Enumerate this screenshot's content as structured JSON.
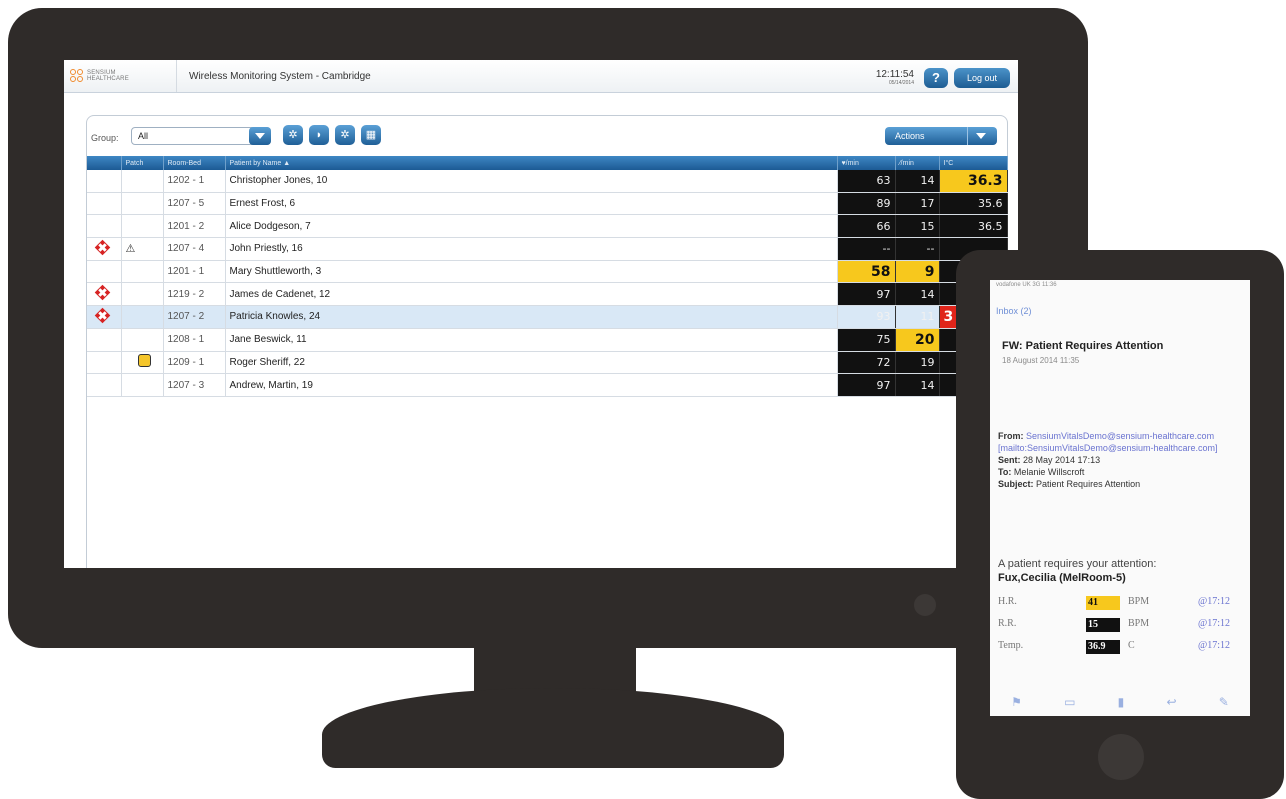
{
  "app": {
    "logo_text_line1": "SENSIUM",
    "logo_text_line2": "HEALTHCARE",
    "title": "Wireless Monitoring System - Cambridge",
    "time": "12:11:54",
    "date": "05/14/2014",
    "help_label": "?",
    "logout_label": "Log out"
  },
  "toolbar": {
    "group_label": "Group:",
    "group_value": "All",
    "actions_label": "Actions"
  },
  "table": {
    "headers": [
      "",
      "Patch",
      "Room-Bed",
      "Patient by Name ▲",
      "♥/min",
      "⁄/min",
      "I°C"
    ],
    "rows": [
      {
        "room": "1202 - 1",
        "name": "Christopher Jones, 10",
        "hr": "63",
        "rr": "14",
        "temp": "36.3"
      },
      {
        "room": "1207 - 5",
        "name": "Ernest Frost, 6",
        "hr": "89",
        "rr": "17",
        "temp": "35.6"
      },
      {
        "room": "1201 - 2",
        "name": "Alice Dodgeson, 7",
        "hr": "66",
        "rr": "15",
        "temp": "36.5"
      },
      {
        "room": "1207 - 4",
        "name": "John Priestly, 16",
        "hr": "--",
        "rr": "--",
        "temp": ""
      },
      {
        "room": "1201 - 1",
        "name": "Mary Shuttleworth,  3",
        "hr": "58",
        "rr": "9",
        "temp": ""
      },
      {
        "room": "1219 - 2",
        "name": "James de Cadenet, 12",
        "hr": "97",
        "rr": "14",
        "temp": ""
      },
      {
        "room": "1207 - 2",
        "name": "Patricia Knowles, 24",
        "hr": "93",
        "rr": "11",
        "temp": "3"
      },
      {
        "room": "1208 - 1",
        "name": "Jane Beswick, 11",
        "hr": "75",
        "rr": "20",
        "temp": ""
      },
      {
        "room": "1209 - 1",
        "name": "Roger Sheriff, 22",
        "hr": "72",
        "rr": "19",
        "temp": ""
      },
      {
        "room": "1207 - 3",
        "name": "Andrew, Martin, 19",
        "hr": "97",
        "rr": "14",
        "temp": ""
      }
    ]
  },
  "email": {
    "status": "vodafone UK  3G  11:36",
    "back": "Inbox (2)",
    "subject": "FW: Patient Requires Attention",
    "date": "18 August 2014 11:35",
    "from_label": "From:",
    "from_value": "SensiumVitalsDemo@sensium-healthcare.com [mailto:SensiumVitalsDemo@sensium-healthcare.com]",
    "sent_label": "Sent:",
    "sent_value": "28 May 2014 17:13",
    "to_label": "To:",
    "to_value": "Melanie Willscroft",
    "subject_label": "Subject:",
    "subject_value": "Patient Requires Attention",
    "body1": "A patient requires your attention:",
    "body2": "Fux,Cecilia (MelRoom-5)",
    "vitals": [
      {
        "label": "H.R.",
        "value": "41",
        "unit": "BPM",
        "time": "@17:12",
        "color": "#f7c81d"
      },
      {
        "label": "R.R.",
        "value": "15",
        "unit": "BPM",
        "time": "@17:12",
        "color": "#111111"
      },
      {
        "label": "Temp.",
        "value": "36.9",
        "unit": "C",
        "time": "@17:12",
        "color": "#111111"
      }
    ]
  }
}
